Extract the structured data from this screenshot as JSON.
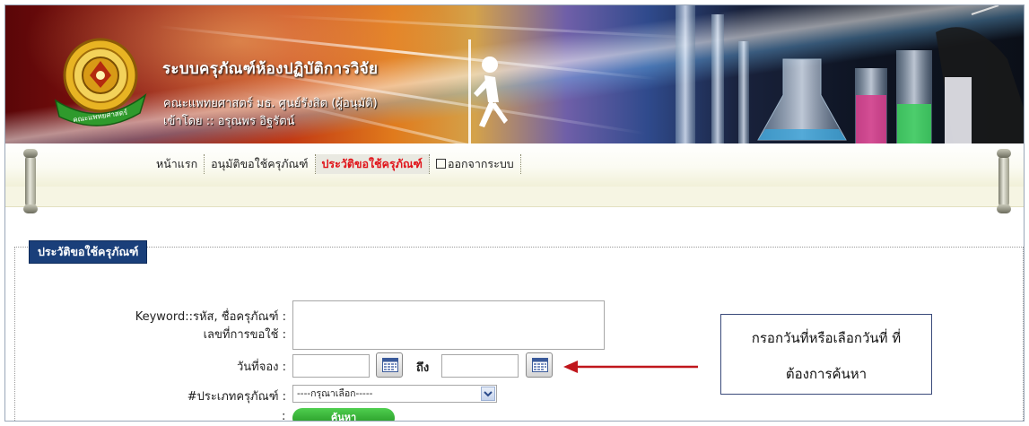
{
  "header": {
    "title": "ระบบครุภัณฑ์ห้องปฏิบัติการวิจัย",
    "subtitle": "คณะแพทยศาสตร์ มธ. ศูนย์รังสิต (ผู้อนุมัติ)",
    "login_text": "เข้าโดย :: อรุณพร อิฐรัตน์",
    "logo_icon": "university-seal-icon",
    "colors": {
      "banner_dark": "#0b0f18",
      "banner_red": "#8d1510",
      "banner_orange": "#e07a1c"
    }
  },
  "nav": {
    "items": [
      {
        "label": "หน้าแรก",
        "active": false
      },
      {
        "label": "อนุมัติขอใช้ครุภัณฑ์",
        "active": false
      },
      {
        "label": "ประวัติขอใช้ครุภัณฑ์",
        "active": true
      },
      {
        "label": "ออกจากระบบ",
        "active": false,
        "icon": "logout-icon"
      }
    ],
    "active_color": "#e0141a"
  },
  "panel": {
    "title": "ประวัติขอใช้ครุภัณฑ์",
    "title_bg": "#1a3f7a"
  },
  "form": {
    "keyword_label": "Keyword::รหัส, ชื่อครุภัณฑ์ :",
    "request_no_label": "เลขที่การขอใช้ :",
    "keyword_value": "",
    "date_label": "วันที่จอง :",
    "date_from_value": "",
    "date_to_label": "ถึง",
    "date_to_value": "",
    "category_label": "#ประเภทครุภัณฑ์ :",
    "category_selected": "----กรุณาเลือก-----",
    "search_colon": ":",
    "search_button": "ค้นหา",
    "calendar_icon": "calendar-icon"
  },
  "annotation": {
    "line1": "กรอกวันที่หรือเลือกวันที่ ที่",
    "line2": "ต้องการค้นหา",
    "arrow_color": "#c0161c"
  }
}
